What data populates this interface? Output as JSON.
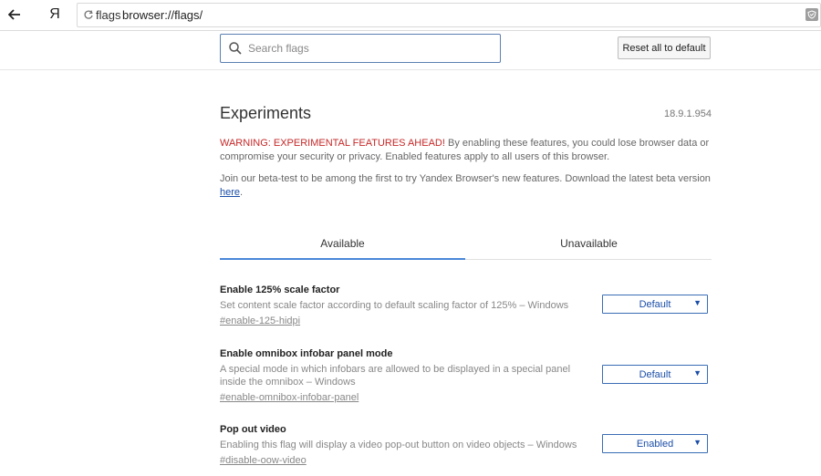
{
  "browser": {
    "logo_text": "Я",
    "url_scheme": "flags",
    "url": "browser://flags/"
  },
  "search": {
    "placeholder": "Search flags"
  },
  "reset_label": "Reset all to default",
  "title": "Experiments",
  "version": "18.9.1.954",
  "warning": {
    "prefix": "WARNING: EXPERIMENTAL FEATURES AHEAD!",
    "text": " By enabling these features, you could lose browser data or compromise your security or privacy. Enabled features apply to all users of this browser."
  },
  "beta": {
    "text": "Join our beta-test to be among the first to try Yandex Browser's new features. Download the latest beta version ",
    "link": "here",
    "suffix": "."
  },
  "tabs": [
    {
      "label": "Available"
    },
    {
      "label": "Unavailable"
    }
  ],
  "experiments": [
    {
      "name": "Enable 125% scale factor",
      "description": "Set content scale factor according to default scaling factor of 125% – Windows",
      "link": "#enable-125-hidpi",
      "value": "Default"
    },
    {
      "name": "Enable omnibox infobar panel mode",
      "description": "A special mode in which infobars are allowed to be displayed in a special panel inside the omnibox – Windows",
      "link": "#enable-omnibox-infobar-panel",
      "value": "Default"
    },
    {
      "name": "Pop out video",
      "description": "Enabling this flag will display a video pop-out button on video objects – Windows",
      "link": "#disable-oow-video",
      "value": "Enabled"
    }
  ],
  "colors": {
    "accent": "#4a87d8",
    "warning": "#c62828",
    "select_border": "#3a6db5"
  }
}
